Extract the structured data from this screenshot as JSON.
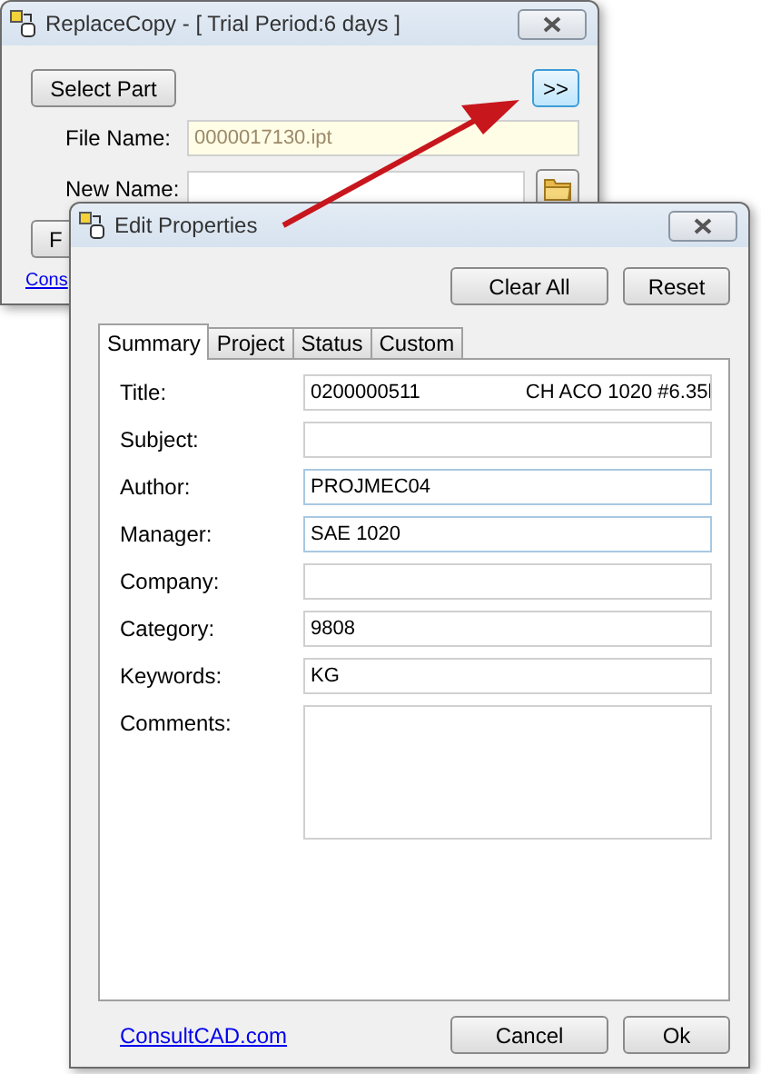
{
  "back_window": {
    "title": "ReplaceCopy - [ Trial Period:6 days ]",
    "select_button": "Select Part",
    "expand_button": {
      "label": ">>",
      "focused": true
    },
    "file_name": {
      "label": "File Name:",
      "value": "0000017130.ipt",
      "readonly": true
    },
    "new_name": {
      "label": "New Name:"
    },
    "hidden_button": "F",
    "link": "Cons"
  },
  "dialog": {
    "title": "Edit Properties",
    "top_buttons": [
      "Clear All",
      "Reset"
    ],
    "tabs": [
      {
        "label": "Summary",
        "selected": true
      },
      {
        "label": "Project",
        "selected": false
      },
      {
        "label": "Status",
        "selected": false
      },
      {
        "label": "Custom",
        "selected": false
      }
    ],
    "fields": [
      {
        "label": "Title:",
        "value": "0200000511                   CH ACO 1020 #6.35l",
        "kind": "line",
        "highlighted": false
      },
      {
        "label": "Subject:",
        "kind": "line",
        "highlighted": false
      },
      {
        "label": "Author:",
        "value": "PROJMEC04",
        "kind": "line",
        "highlighted": true
      },
      {
        "label": "Manager:",
        "value": "SAE 1020",
        "kind": "line",
        "highlighted": true
      },
      {
        "label": "Company:",
        "kind": "line",
        "highlighted": false
      },
      {
        "label": "Category:",
        "value": "9808",
        "kind": "line",
        "highlighted": false
      },
      {
        "label": "Keywords:",
        "value": "KG",
        "kind": "line",
        "highlighted": false
      },
      {
        "label": "Comments:",
        "kind": "multiline",
        "highlighted": false
      }
    ],
    "link": "ConsultCAD.com",
    "bottom_buttons": [
      "Cancel",
      "Ok"
    ]
  }
}
